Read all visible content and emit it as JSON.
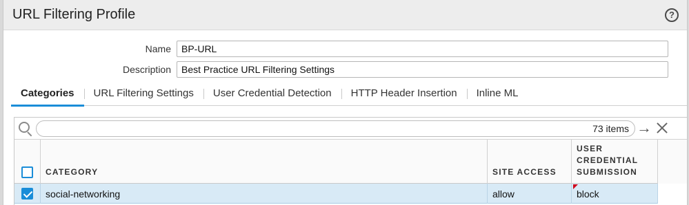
{
  "dialog": {
    "title": "URL Filtering Profile",
    "help_icon": "help-circle-icon"
  },
  "form": {
    "name_label": "Name",
    "name_value": "BP-URL",
    "description_label": "Description",
    "description_value": "Best Practice URL Filtering Settings"
  },
  "tabs": [
    {
      "label": "Categories",
      "active": true
    },
    {
      "label": "URL Filtering Settings",
      "active": false
    },
    {
      "label": "User Credential Detection",
      "active": false
    },
    {
      "label": "HTTP Header Insertion",
      "active": false
    },
    {
      "label": "Inline ML",
      "active": false
    }
  ],
  "grid": {
    "search_value": "",
    "items_count": "73 items",
    "icons": {
      "search": "search-icon",
      "go": "arrow-right-icon",
      "clear": "close-icon"
    },
    "columns": {
      "category": "CATEGORY",
      "site_access": "SITE ACCESS",
      "user_credential_submission": "USER\nCREDENTIAL\nSUBMISSION"
    },
    "header_checkbox_checked": false,
    "rows": [
      {
        "checked": true,
        "category": "social-networking",
        "site_access": "allow",
        "user_credential_submission": "block",
        "modified": true
      }
    ]
  },
  "colors": {
    "accent": "#1a8dd8",
    "selected_row": "#d8eaf6",
    "modified_marker": "#d0021b"
  }
}
